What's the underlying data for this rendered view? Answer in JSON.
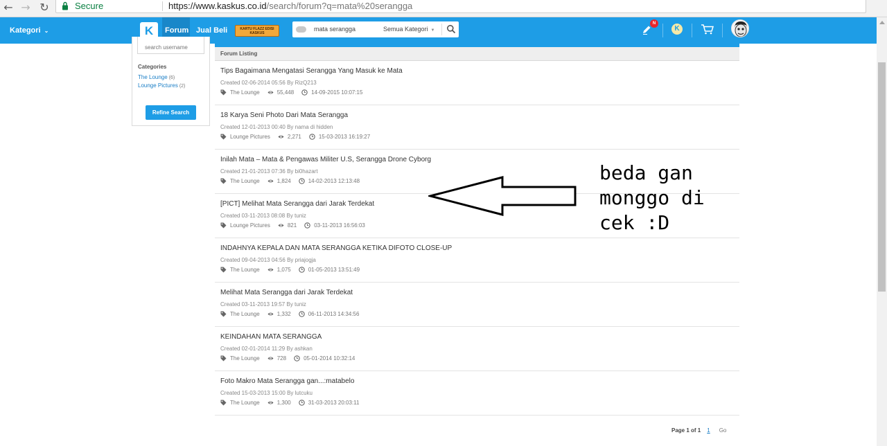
{
  "browser": {
    "secure_label": "Secure",
    "url_host": "https://www.kaskus.co.id",
    "url_path": "/search/forum?q=mata%20serangga",
    "nav_icons": [
      "back-arrow-icon",
      "forward-arrow-icon",
      "reload-icon"
    ]
  },
  "header": {
    "kategori_label": "Kategori",
    "forum_label": "Forum",
    "jual_beli_label": "Jual Beli",
    "promo_text": "KARTU FLAZZ EDISI KASKUS",
    "search_query": "mata serangga",
    "search_category": "Semua Kategori",
    "notification_count": "N",
    "brand_color": "#1e9de6"
  },
  "filter": {
    "username_placeholder": "search username",
    "categories_title": "Categories",
    "categories": [
      {
        "name": "The Lounge",
        "count": "(6)"
      },
      {
        "name": "Lounge Pictures",
        "count": "(2)"
      }
    ],
    "refine_label": "Refine Search"
  },
  "listing": {
    "header": "Forum Listing",
    "threads": [
      {
        "title": "Tips Bagaimana Mengatasi Serangga Yang Masuk ke Mata",
        "created": "Created 02-06-2014 05:56 By RizQ213",
        "category": "The Lounge",
        "views": "55,448",
        "last": "14-09-2015 10:07:15"
      },
      {
        "title": "18 Karya Seni Photo Dari Mata Serangga",
        "created": "Created 12-01-2013 00:40 By nama di hidden",
        "category": "Lounge Pictures",
        "views": "2,271",
        "last": "15-03-2013 16:19:27"
      },
      {
        "title": "Inilah Mata – Mata & Pengawas Militer U.S, Serangga Drone Cyborg",
        "created": "Created 21-01-2013 07:36 By bi0hazart",
        "category": "The Lounge",
        "views": "1,824",
        "last": "14-02-2013 12:13:48"
      },
      {
        "title": "[PICT] Melihat Mata Serangga dari Jarak Terdekat",
        "created": "Created 03-11-2013 08:08 By tuniz",
        "category": "Lounge Pictures",
        "views": "821",
        "last": "03-11-2013 16:56:03"
      },
      {
        "title": "INDAHNYA KEPALA DAN MATA SERANGGA KETIKA DIFOTO CLOSE-UP",
        "created": "Created 09-04-2013 04:56 By priajogja",
        "category": "The Lounge",
        "views": "1,075",
        "last": "01-05-2013 13:51:49"
      },
      {
        "title": "Melihat Mata Serangga dari Jarak Terdekat",
        "created": "Created 03-11-2013 19:57 By tuniz",
        "category": "The Lounge",
        "views": "1,332",
        "last": "06-11-2013 14:34:56"
      },
      {
        "title": "KEINDAHAN MATA SERANGGA",
        "created": "Created 02-01-2014 11:29 By ashkan",
        "category": "The Lounge",
        "views": "728",
        "last": "05-01-2014 10:32:14"
      },
      {
        "title": "Foto Makro Mata Serangga gan...:matabelo",
        "created": "Created 15-03-2013 15:00 By lutcuku",
        "category": "The Lounge",
        "views": "1,300",
        "last": "31-03-2013 20:03:11"
      }
    ]
  },
  "pagination": {
    "label": "Page 1 of 1",
    "current": "1",
    "go": "Go"
  },
  "annotation": {
    "text": "beda gan\nmonggo di\ncek :D"
  }
}
